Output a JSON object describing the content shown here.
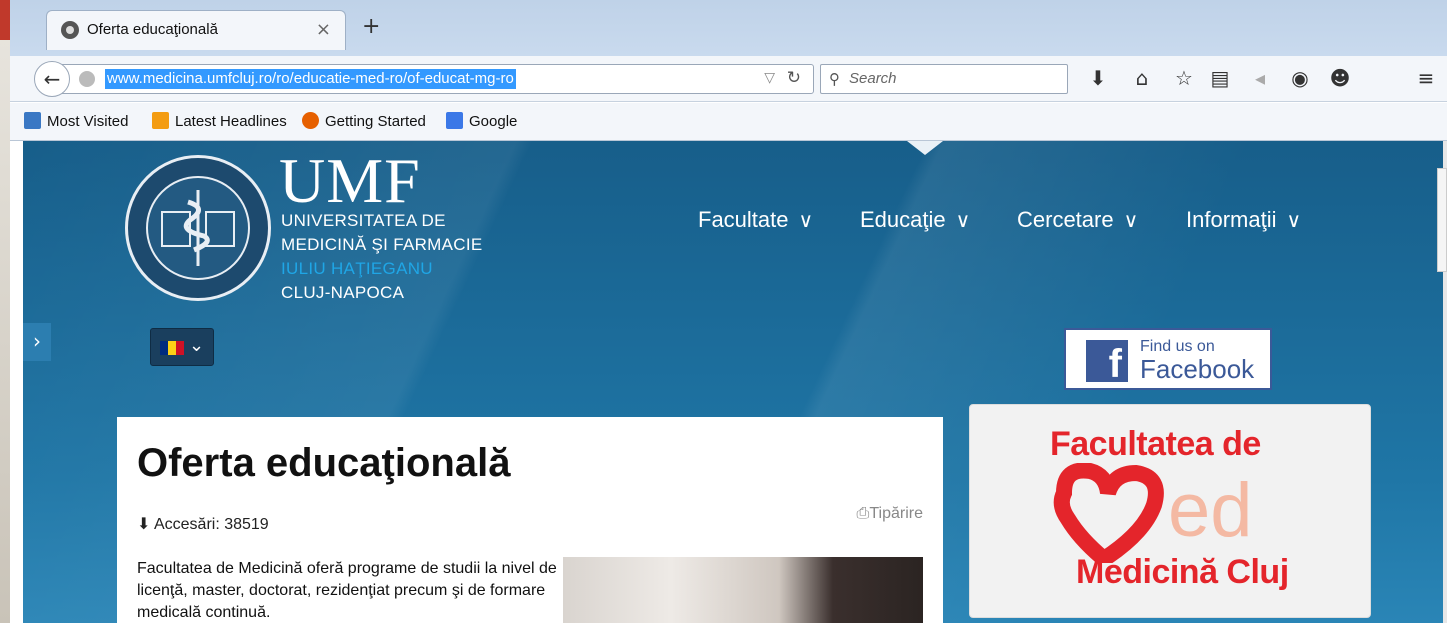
{
  "browser": {
    "tab_title": "Oferta educaţională",
    "tab_close": "×",
    "new_tab": "+",
    "url": "www.medicina.umfcluj.ro/ro/educatie-med-ro/of-educat-mg-ro",
    "search_placeholder": "Search",
    "bookmarks": [
      {
        "label": "Most Visited",
        "icon": "most-visited-icon",
        "color": "#3a78c4"
      },
      {
        "label": "Latest Headlines",
        "icon": "rss-icon",
        "color": "#f39c12"
      },
      {
        "label": "Getting Started",
        "icon": "firefox-icon",
        "color": "#e66000"
      },
      {
        "label": "Google",
        "icon": "google-icon",
        "color": "#3b78e7"
      }
    ]
  },
  "site": {
    "logo_umf": "UMF",
    "logo_lines": [
      "UNIVERSITATEA DE",
      "MEDICINĂ ŞI FARMACIE",
      "IULIU HAŢIEGANU",
      "CLUJ-NAPOCA"
    ],
    "logo_highlight_color": "#1fa6e6",
    "nav": [
      "Facultate",
      "Educaţie",
      "Cercetare",
      "Informaţii"
    ],
    "nav_active_index": 1,
    "facebook_line1": "Find us on",
    "facebook_line2": "Facebook",
    "promo_line1": "Facultatea de",
    "promo_line2": "Medicină Cluj",
    "promo_ed": "ed",
    "brand_color": "#e4252b"
  },
  "article": {
    "title": "Oferta educaţională",
    "hits": "Accesări: 38519",
    "print_label": "Tipărire",
    "intro": "Facultatea de Medicină oferă programe de studii la nivel de licenţă, master, doctorat, rezidenţiat precum şi de formare medicală continuă."
  }
}
